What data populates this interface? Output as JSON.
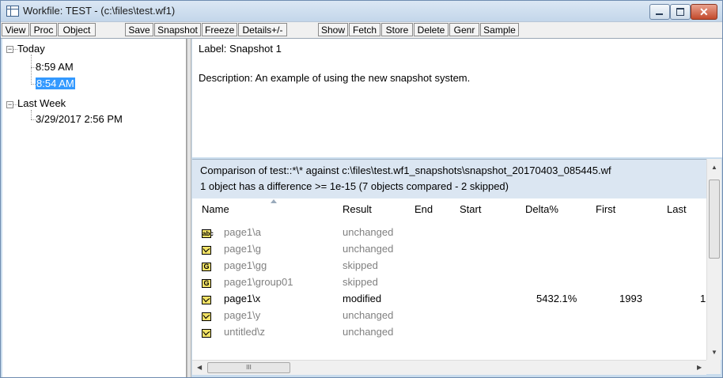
{
  "window": {
    "title": "Workfile: TEST - (c:\\files\\test.wf1)",
    "min_glyph": "",
    "close_glyph": "✕"
  },
  "toolbar": {
    "view": "View",
    "proc": "Proc",
    "object": "Object",
    "save": "Save",
    "snapshot": "Snapshot",
    "freeze": "Freeze",
    "details": "Details+/-",
    "show": "Show",
    "fetch": "Fetch",
    "store": "Store",
    "delete": "Delete",
    "genr": "Genr",
    "sample": "Sample"
  },
  "tree": {
    "today": {
      "label": "Today",
      "toggle": "−",
      "items": [
        "8:59 AM",
        "8:54 AM"
      ]
    },
    "last_week": {
      "label": "Last Week",
      "toggle": "−",
      "items": [
        "3/29/2017 2:56 PM"
      ]
    }
  },
  "snapshot": {
    "label": "Label: Snapshot 1",
    "description": "Description: An example of using the new snapshot system."
  },
  "comparison": {
    "line1": "Comparison of test::*\\* against c:\\files\\test.wf1_snapshots\\snapshot_20170403_085445.wf",
    "line2": "1 object has a difference >= 1e-15  (7 objects compared - 2 skipped)"
  },
  "table": {
    "columns": [
      "Name",
      "Result",
      "End",
      "Start",
      "Delta%",
      "First",
      "Last"
    ],
    "rows": [
      {
        "icon": "abc",
        "name": "page1\\a",
        "result": "unchanged",
        "delta": "",
        "first": "",
        "last": ""
      },
      {
        "icon": "series",
        "name": "page1\\g",
        "result": "unchanged",
        "delta": "",
        "first": "",
        "last": ""
      },
      {
        "icon": "G",
        "name": "page1\\gg",
        "result": "skipped",
        "delta": "",
        "first": "",
        "last": ""
      },
      {
        "icon": "G",
        "name": "page1\\group01",
        "result": "skipped",
        "delta": "",
        "first": "",
        "last": ""
      },
      {
        "icon": "series",
        "name": "page1\\x",
        "result": "modified",
        "delta": "5432.1%",
        "first": "1993",
        "last": "1"
      },
      {
        "icon": "series",
        "name": "page1\\y",
        "result": "unchanged",
        "delta": "",
        "first": "",
        "last": ""
      },
      {
        "icon": "series",
        "name": "untitled\\z",
        "result": "unchanged",
        "delta": "",
        "first": "",
        "last": ""
      }
    ]
  },
  "scroll": {
    "up": "▲",
    "down": "▼",
    "left": "◀",
    "right": "▶",
    "thumb_grip": "III",
    "vthumb_grip": "≡"
  }
}
